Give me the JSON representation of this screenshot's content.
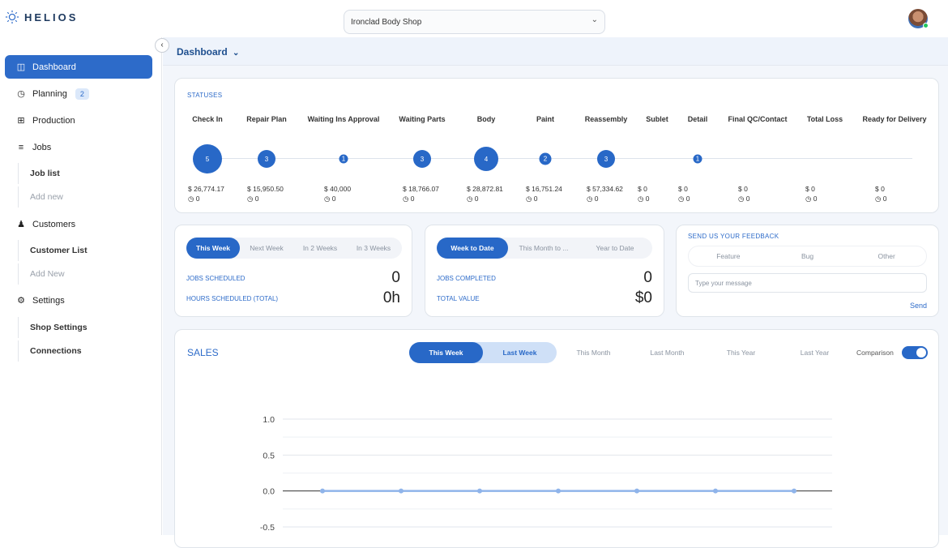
{
  "app": {
    "name": "HELIOS",
    "shop": "Ironclad Body Shop"
  },
  "sidebar": {
    "items": [
      {
        "label": "Dashboard",
        "icon": "dashboard-icon"
      },
      {
        "label": "Planning",
        "icon": "clock-icon",
        "badge": "2"
      },
      {
        "label": "Production",
        "icon": "grid-icon"
      },
      {
        "label": "Jobs",
        "icon": "jobs-icon"
      },
      {
        "label": "Customers",
        "icon": "users-icon"
      },
      {
        "label": "Settings",
        "icon": "gear-icon"
      }
    ],
    "jobs_sub": [
      "Job list",
      "Add new"
    ],
    "customers_sub": [
      "Customer List",
      "Add New"
    ],
    "settings_sub": [
      "Shop Settings",
      "Connections"
    ]
  },
  "header": {
    "title": "Dashboard"
  },
  "statuses": {
    "title": "STATUSES",
    "items": [
      {
        "label": "Check In",
        "count": "5",
        "amount": "$ 26,774.17",
        "sub": "0"
      },
      {
        "label": "Repair Plan",
        "count": "3",
        "amount": "$ 15,950.50",
        "sub": "0"
      },
      {
        "label": "Waiting Ins Approval",
        "count": "1",
        "amount": "$ 40,000",
        "sub": "0"
      },
      {
        "label": "Waiting Parts",
        "count": "3",
        "amount": "$ 18,766.07",
        "sub": "0"
      },
      {
        "label": "Body",
        "count": "4",
        "amount": "$ 28,872.81",
        "sub": "0"
      },
      {
        "label": "Paint",
        "count": "2",
        "amount": "$ 16,751.24",
        "sub": "0"
      },
      {
        "label": "Reassembly",
        "count": "3",
        "amount": "$ 57,334.62",
        "sub": "0"
      },
      {
        "label": "Sublet",
        "count": "",
        "amount": "$ 0",
        "sub": "0"
      },
      {
        "label": "Detail",
        "count": "1",
        "amount": "$ 0",
        "sub": "0"
      },
      {
        "label": "Final QC/Contact",
        "count": "",
        "amount": "$ 0",
        "sub": "0"
      },
      {
        "label": "Total Loss",
        "count": "",
        "amount": "$ 0",
        "sub": "0"
      },
      {
        "label": "Ready for Delivery",
        "count": "",
        "amount": "$ 0",
        "sub": "0"
      }
    ]
  },
  "schedule": {
    "tabs": [
      "This Week",
      "Next Week",
      "In 2 Weeks",
      "In 3 Weeks"
    ],
    "jobs_label": "JOBS SCHEDULED",
    "jobs_value": "0",
    "hours_label": "HOURS SCHEDULED (TOTAL)",
    "hours_value": "0h"
  },
  "completed": {
    "tabs": [
      "Week to Date",
      "This Month to ...",
      "Year to Date"
    ],
    "jobs_label": "JOBS COMPLETED",
    "jobs_value": "0",
    "value_label": "TOTAL VALUE",
    "value_value": "$0"
  },
  "feedback": {
    "title": "SEND US YOUR FEEDBACK",
    "tabs": [
      "Feature",
      "Bug",
      "Other"
    ],
    "placeholder": "Type your message",
    "send": "Send"
  },
  "sales": {
    "title": "SALES",
    "tabs": [
      "This Week",
      "Last Week",
      "This Month",
      "Last Month",
      "This Year",
      "Last Year"
    ],
    "comparison": "Comparison",
    "comparison_on": true
  },
  "chart_data": {
    "type": "line",
    "yticks": [
      "1.0",
      "0.5",
      "0.0",
      "-0.5"
    ],
    "ylim": [
      -0.5,
      1.0
    ],
    "series": [
      {
        "values": [
          0,
          0,
          0,
          0,
          0,
          0,
          0
        ]
      }
    ]
  },
  "colors": {
    "accent": "#2868c7",
    "line": "#8fb4ea"
  }
}
